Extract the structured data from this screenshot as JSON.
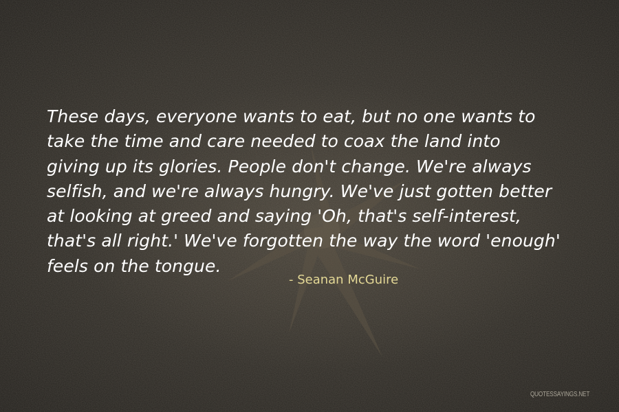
{
  "quote": {
    "text": "These days, everyone wants to eat, but no one wants to\ntake the time and care needed to coax the land into\ngiving up its glories. People don't change. We're always\nselfish, and we're always hungry. We've just gotten better\nat looking at greed and saying 'Oh, that's self-interest,\nthat's all right.' We've forgotten the way the word 'enough'\nfeels on the tongue."
  },
  "author": "- Seanan McGuire",
  "watermark": "QUOTESSAYINGS.NET",
  "colors": {
    "background": "#2e2b26",
    "quote_text": "#ffffff",
    "author_text": "#e4d896",
    "watermark_text": "#a9a497"
  }
}
